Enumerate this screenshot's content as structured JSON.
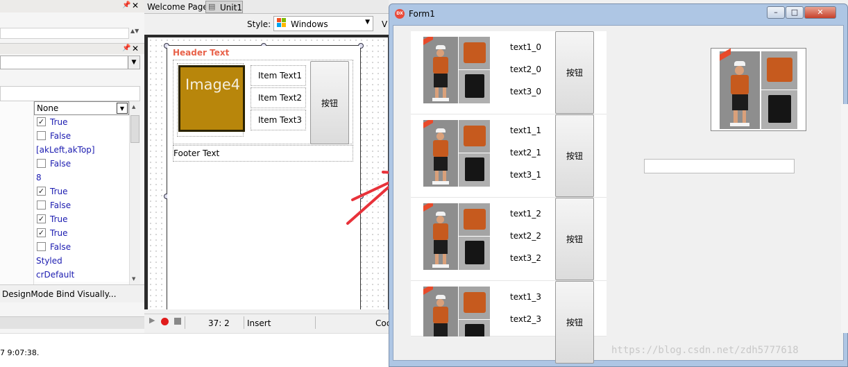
{
  "inspector": {
    "none_value": "None",
    "props": [
      "True",
      "False",
      "[akLeft,akTop]",
      "False",
      "8",
      "True",
      "False",
      "True",
      "True",
      "False",
      "Styled",
      "crDefault"
    ],
    "checks": [
      true,
      false,
      null,
      false,
      null,
      true,
      false,
      true,
      true,
      false,
      null,
      null
    ],
    "bottom_links": "DesignMode Bind Visually...",
    "status_time": "7 9:07:38."
  },
  "designer": {
    "tabs": [
      "Welcome Page",
      "Unit1"
    ],
    "style_label": "Style:",
    "style_value": "Windows",
    "style_cut": "V",
    "header_text": "Header Text",
    "image_text": "Image4",
    "items": [
      "Item Text1",
      "Item Text2",
      "Item Text3"
    ],
    "button_text": "按钮",
    "footer_text": "Footer Text",
    "status_pos": "37:  2",
    "status_mode": "Insert",
    "status_cut": "Coc"
  },
  "form": {
    "title": "Form1",
    "title_icon_text": "DX",
    "controls": [
      "–",
      "□",
      "✕"
    ],
    "rows": [
      {
        "t1": "text1_0",
        "t2": "text2_0",
        "t3": "text3_0",
        "btn": "按钮"
      },
      {
        "t1": "text1_1",
        "t2": "text2_1",
        "t3": "text3_1",
        "btn": "按钮"
      },
      {
        "t1": "text1_2",
        "t2": "text2_2",
        "t3": "text3_2",
        "btn": "按钮"
      },
      {
        "t1": "text1_3",
        "t2": "text2_3",
        "t3": "",
        "btn": "按钮"
      }
    ],
    "edit_value": ""
  },
  "watermark": "https://blog.csdn.net/zdh5777618",
  "colors": {
    "accent_red": "#e8323a",
    "header_orange": "#e8624a",
    "image_gold": "#b8860b",
    "prop_blue": "#1b1bb0"
  }
}
